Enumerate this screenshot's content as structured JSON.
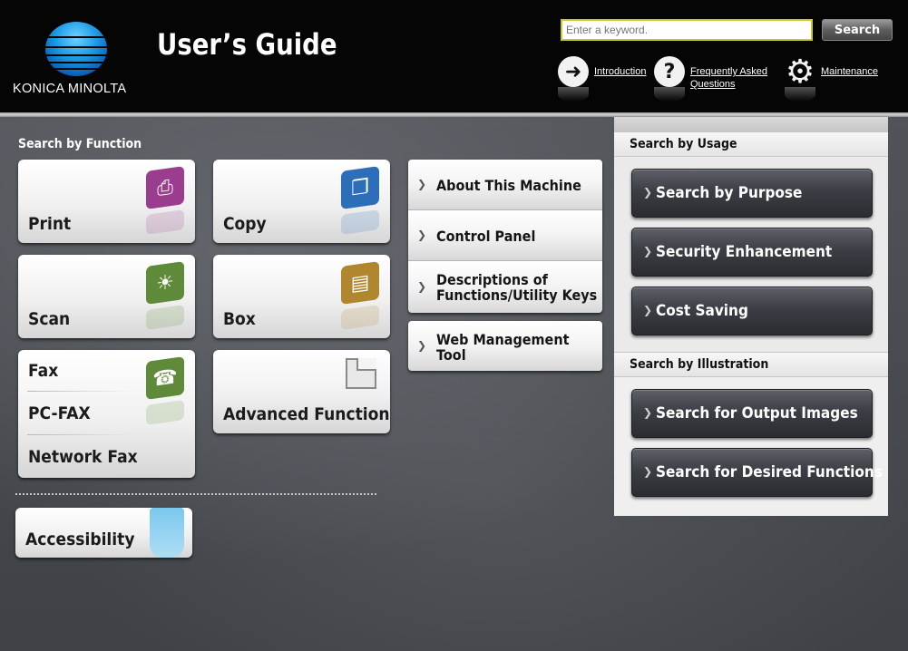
{
  "brand": {
    "logo_text": "KONICA MINOLTA",
    "guide_title": "User’s Guide",
    "globe_color": "#1e9de6"
  },
  "search": {
    "placeholder": "Enter a keyword.",
    "button_label": "Search"
  },
  "header_links": [
    {
      "label": "Introduction",
      "icon": "arrow-right-icon"
    },
    {
      "label_line1": "Frequently Asked",
      "label_line2": "Questions",
      "icon": "question-icon"
    },
    {
      "label": "Maintenance",
      "icon": "gear-icon"
    }
  ],
  "search_by_function": {
    "title": "Search by Function",
    "tiles": {
      "print": {
        "label": "Print",
        "icon": "print-icon",
        "color": "#9b3d8e"
      },
      "copy": {
        "label": "Copy",
        "icon": "copy-icon",
        "color": "#2c6fb8"
      },
      "scan": {
        "label": "Scan",
        "icon": "scan-icon",
        "color": "#5f8a3a"
      },
      "box": {
        "label": "Box",
        "icon": "box-icon",
        "color": "#b0872f"
      },
      "fax": {
        "label": "Fax",
        "icon": "fax-icon",
        "color": "#5f8a3a"
      },
      "pc_fax": {
        "label": "PC-FAX"
      },
      "network_fax": {
        "label": "Network Fax"
      },
      "advanced": {
        "label": "Advanced Function",
        "icon": "document-icon"
      },
      "accessibility": {
        "label": "Accessibility",
        "icon": "hand-icon",
        "color": "#8fd0f0"
      }
    },
    "links": [
      {
        "label": "About This Machine"
      },
      {
        "label": "Control Panel"
      },
      {
        "label_line1": "Descriptions of",
        "label_line2": "Functions/Utility Keys"
      },
      {
        "label_line1": "Web Management",
        "label_line2": "Tool"
      }
    ]
  },
  "search_by_usage": {
    "title": "Search by Usage",
    "items": [
      "Search by Purpose",
      "Security Enhancement",
      "Cost Saving"
    ]
  },
  "search_by_illustration": {
    "title": "Search by Illustration",
    "items": [
      "Search for Output Images",
      "Search for Desired Functions"
    ]
  }
}
